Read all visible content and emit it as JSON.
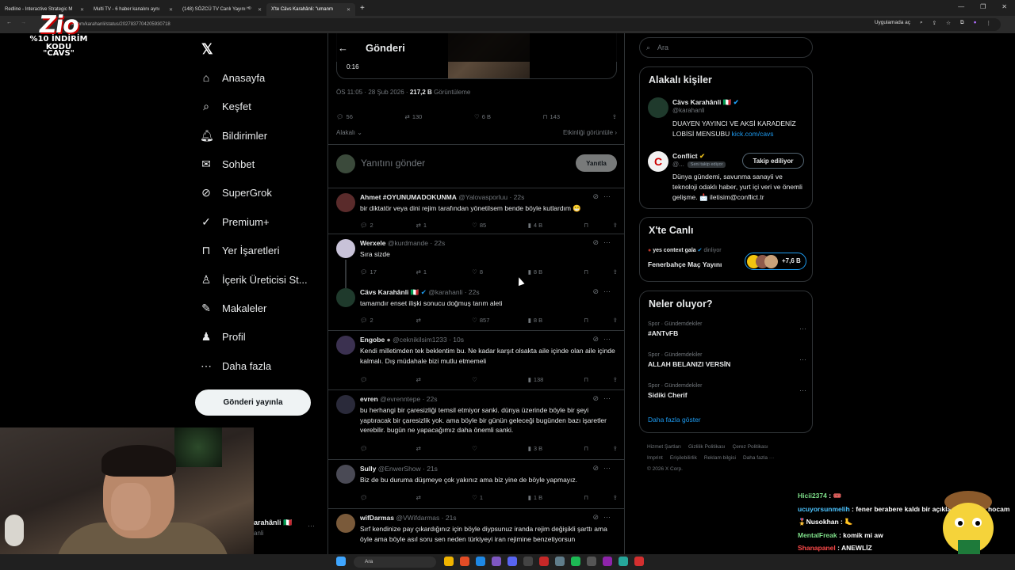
{
  "browser": {
    "tabs": [
      {
        "label": "Redline - Interactive Strategic M",
        "active": false
      },
      {
        "label": "Multi TV - 6 haber kanalını aynı",
        "active": false
      },
      {
        "label": "(148) SÖZCÜ TV Canlı Yayını ᴴᴰ",
        "active": false
      },
      {
        "label": "X'te Cävs Karahânli: \"umanm",
        "active": true
      }
    ],
    "url": "x.com/karahanli/status/2027837704205930718",
    "open_in_app": "Uygulamada aç"
  },
  "overlay_logo": {
    "big": "Zio",
    "line1": "%10 İNDİRİM KODU",
    "line2": "\"CAVS\""
  },
  "nav": {
    "items": [
      {
        "label": "Anasayfa",
        "icon": "home-icon"
      },
      {
        "label": "Keşfet",
        "icon": "search-icon"
      },
      {
        "label": "Bildirimler",
        "icon": "bell-icon"
      },
      {
        "label": "Sohbet",
        "icon": "mail-icon"
      },
      {
        "label": "SuperGrok",
        "icon": "grok-icon"
      },
      {
        "label": "Premium+",
        "icon": "verified-icon"
      },
      {
        "label": "Yer İşaretleri",
        "icon": "bookmark-icon"
      },
      {
        "label": "İçerik Üreticisi St...",
        "icon": "creator-icon"
      },
      {
        "label": "Makaleler",
        "icon": "article-icon"
      },
      {
        "label": "Profil",
        "icon": "person-icon"
      },
      {
        "label": "Daha fazla",
        "icon": "more-circle-icon"
      }
    ],
    "post_button": "Gönderi yayınla"
  },
  "main": {
    "title": "Gönderi",
    "video_time": "0:16",
    "meta_time": "ÖS 11:05 · 28 Şub 2026 ·",
    "meta_views": "217,2 B",
    "meta_views_label": "Görüntüleme",
    "stats": {
      "replies": "56",
      "reposts": "130",
      "likes": "6 B",
      "bookmarks": "143"
    },
    "sort_label": "Alakalı",
    "engagement_link": "Etkinliği görüntüle",
    "reply_placeholder": "Yanıtını gönder",
    "reply_button": "Yanıtla",
    "replies": [
      {
        "name": "Ahmet #OYUNUMADOKUNMA",
        "handle": "@Yalovasporluu · 22s",
        "text": "bir diktatör veya dini rejim tarafından yönetilsem bende böyle kutlardım 😁",
        "replies": "2",
        "reposts": "1",
        "likes": "85",
        "views": "4 B"
      },
      {
        "name": "Werxele",
        "handle": "@kurdmande · 22s",
        "text": "Sıra sizde",
        "replies": "17",
        "reposts": "1",
        "likes": "8",
        "views": "8 B"
      },
      {
        "name": "Cävs Karahânli 🇮🇹",
        "handle": "@karahanli · 22s",
        "text": "tamamdır enset ilişki sonucu doğmuş tarım aleti",
        "replies": "2",
        "reposts": "",
        "likes": "857",
        "views": "8 B"
      },
      {
        "name": "Engobe",
        "handle": "@ceknikilsim1233 · 10s",
        "text": "Kendi milletimden tek beklentim bu. Ne kadar karşıt olsakta aile içinde olan aile içinde kalmalı. Dış müdahale bizi mutlu etmemeli",
        "replies": "",
        "reposts": "",
        "likes": "",
        "views": "138"
      },
      {
        "name": "evren",
        "handle": "@evrenntepe · 22s",
        "text": "bu herhangi bir çaresizliği temsil etmiyor sanki. dünya üzerinde böyle bir şeyi yaptıracak bir çaresizlik yok. ama böyle bir günün geleceği bugünden bazı işaretler verebilir. bugün ne yapacağımız daha önemli sanki.",
        "replies": "",
        "reposts": "",
        "likes": "",
        "views": "3 B"
      },
      {
        "name": "Sully",
        "handle": "@EnwerShow · 21s",
        "text": "Biz de bu duruma düşmeye çok yakınız ama biz yine de böyle yapmayız.",
        "replies": "",
        "reposts": "",
        "likes": "1",
        "views": "1 B"
      },
      {
        "name": "wifDarmas",
        "handle": "@VWifdarmas · 21s",
        "text": "Sırf kendinize pay çıkardığınız için böyle diypsunuz iranda rejim değişikli şarttı ama öyle ama böyle asıl soru sen neden türkiyeyi iran rejimine benzetiyorsun",
        "replies": "",
        "reposts": "",
        "likes": "",
        "views": ""
      }
    ]
  },
  "right": {
    "search_placeholder": "Ara",
    "related_title": "Alakalı kişiler",
    "people": [
      {
        "name": "Cävs Karahânli 🇮🇹",
        "handle": "@karahanli",
        "bio": "DUAYEN YAYINCI VE AKSİ KARADENİZ LOBİSİ MENSUBU",
        "link": "kick.com/cavs"
      },
      {
        "name": "Conflict",
        "handle": "@...",
        "pill": "Seni takip ediyor",
        "follow_label": "Takip ediliyor",
        "bio": "Dünya gündemi, savunma sanayii ve teknoloji odaklı haber, yurt içi veri ve önemli gelişme. 📩 iletisim@conflict.tr"
      }
    ],
    "live_title": "X'te Canlı",
    "live_host": "yes context gala",
    "live_host_status": "dinliyor",
    "live_event": "Fenerbahçe Maç Yayını",
    "live_count": "+7,6 B",
    "trends_title": "Neler oluyor?",
    "trends": [
      {
        "cat": "Spor · Gündemdekiler",
        "title": "#ANTvFB"
      },
      {
        "cat": "Spor · Gündemdekiler",
        "title": "ALLAH BELANIZI VERSİN"
      },
      {
        "cat": "Spor · Gündemdekiler",
        "title": "Sidiki Cherif"
      }
    ],
    "show_more": "Daha fazla göster",
    "footer": [
      "Hizmet Şartları",
      "Gizlilik Politikası",
      "Çerez Politikası",
      "Imprint",
      "Erişilebilirlik",
      "Reklam bilgisi",
      "Daha fazla ···",
      "© 2026 X Corp."
    ]
  },
  "stream_overlay": {
    "occluded_name": "arahânli 🇮🇹",
    "occluded_handle": "anli",
    "chat": [
      {
        "user": "Hicii2374",
        "msg": "🎟️"
      },
      {
        "user": "ucuyorsunmelih",
        "msg": "fener berabere kaldı bir açıklama yok mu hocam"
      },
      {
        "user": "Nusokhan",
        "msg": "🦶"
      },
      {
        "user": "MentalFreak",
        "msg": "komik mi aw"
      },
      {
        "user": "Shanapanel",
        "msg": "ANEWLİZ"
      }
    ]
  },
  "taskbar": {
    "search": "Ara"
  }
}
